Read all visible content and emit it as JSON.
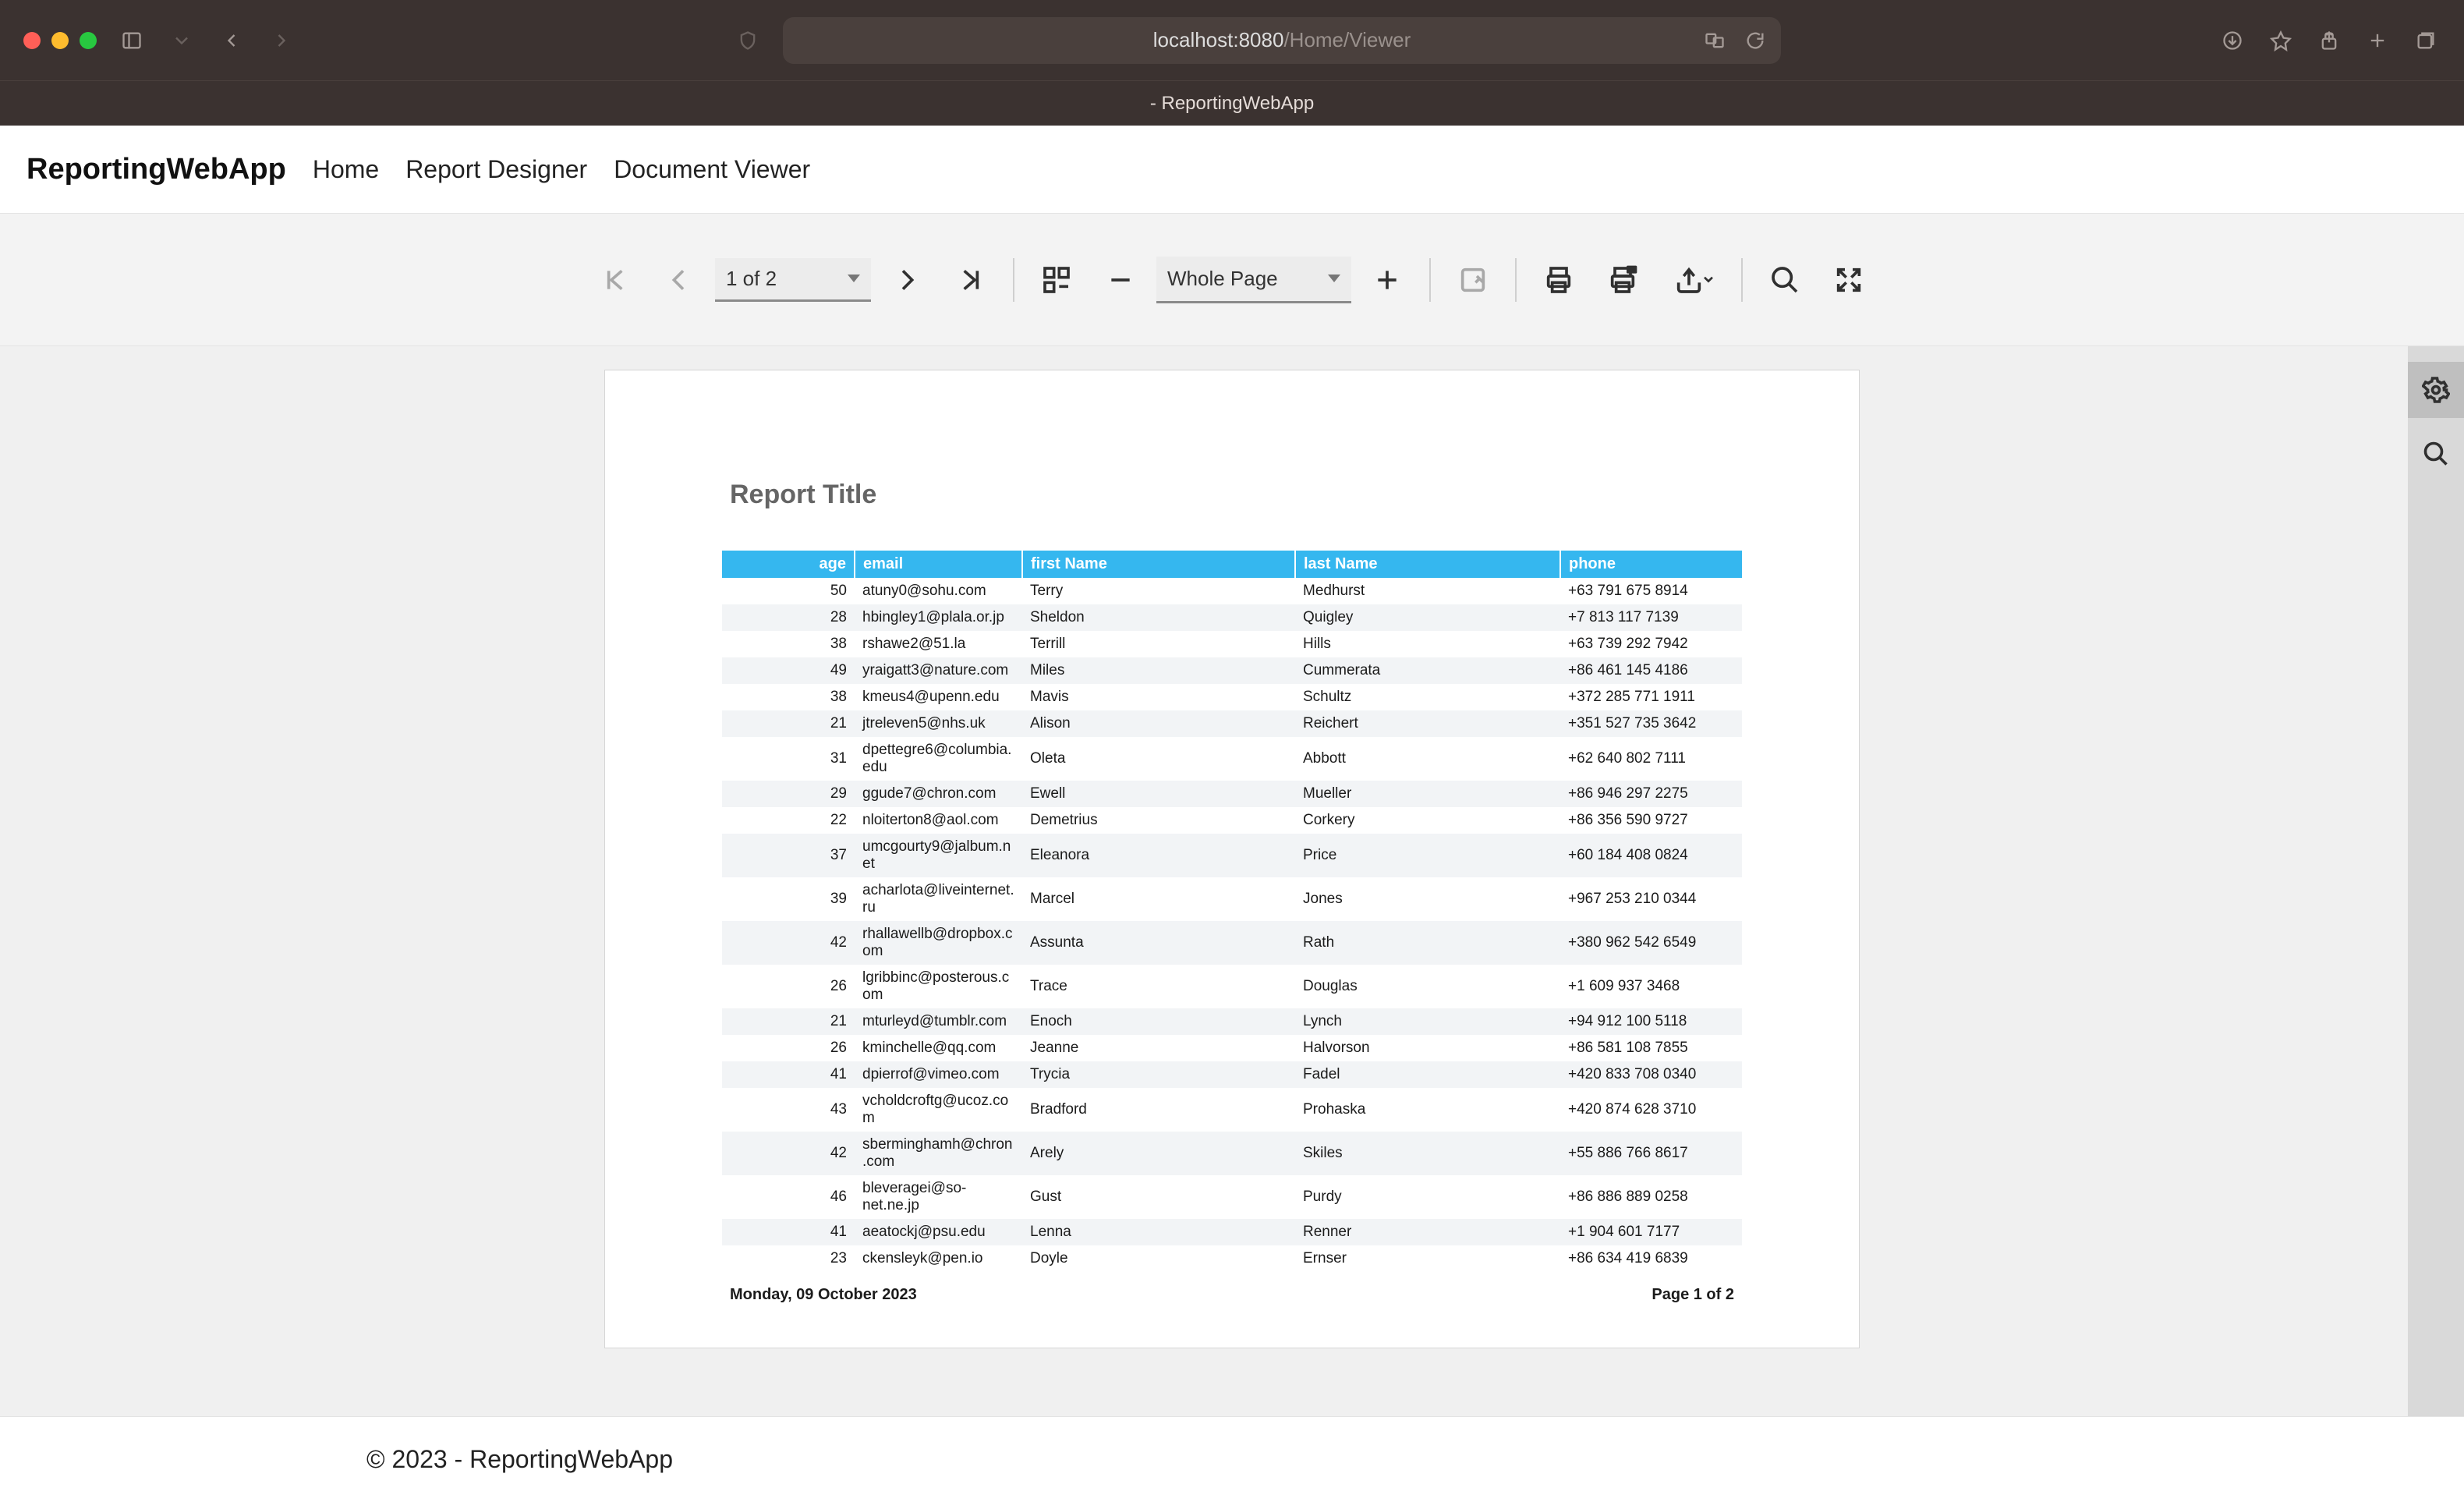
{
  "browser": {
    "url_host": "localhost:8080",
    "url_path": "/Home/Viewer",
    "tab_title": "- ReportingWebApp"
  },
  "nav": {
    "brand": "ReportingWebApp",
    "links": {
      "home": "Home",
      "designer": "Report Designer",
      "viewer": "Document Viewer"
    }
  },
  "toolbar": {
    "page_indicator": "1 of 2",
    "zoom_mode": "Whole Page"
  },
  "report": {
    "title": "Report Title",
    "columns": {
      "age": "age",
      "email": "email",
      "first_name": "first Name",
      "last_name": "last Name",
      "phone": "phone"
    },
    "rows": [
      {
        "age": "50",
        "email": "atuny0@sohu.com",
        "first": "Terry",
        "last": "Medhurst",
        "phone": "+63 791 675 8914"
      },
      {
        "age": "28",
        "email": "hbingley1@plala.or.jp",
        "first": "Sheldon",
        "last": "Quigley",
        "phone": "+7 813 117 7139"
      },
      {
        "age": "38",
        "email": "rshawe2@51.la",
        "first": "Terrill",
        "last": "Hills",
        "phone": "+63 739 292 7942"
      },
      {
        "age": "49",
        "email": "yraigatt3@nature.com",
        "first": "Miles",
        "last": "Cummerata",
        "phone": "+86 461 145 4186"
      },
      {
        "age": "38",
        "email": "kmeus4@upenn.edu",
        "first": "Mavis",
        "last": "Schultz",
        "phone": "+372 285 771 1911"
      },
      {
        "age": "21",
        "email": "jtreleven5@nhs.uk",
        "first": "Alison",
        "last": "Reichert",
        "phone": "+351 527 735 3642"
      },
      {
        "age": "31",
        "email": "dpettegre6@columbia.edu",
        "first": "Oleta",
        "last": "Abbott",
        "phone": "+62 640 802 7111"
      },
      {
        "age": "29",
        "email": "ggude7@chron.com",
        "first": "Ewell",
        "last": "Mueller",
        "phone": "+86 946 297 2275"
      },
      {
        "age": "22",
        "email": "nloiterton8@aol.com",
        "first": "Demetrius",
        "last": "Corkery",
        "phone": "+86 356 590 9727"
      },
      {
        "age": "37",
        "email": "umcgourty9@jalbum.net",
        "first": "Eleanora",
        "last": "Price",
        "phone": "+60 184 408 0824"
      },
      {
        "age": "39",
        "email": "acharlota@liveinternet.ru",
        "first": "Marcel",
        "last": "Jones",
        "phone": "+967 253 210 0344"
      },
      {
        "age": "42",
        "email": "rhallawellb@dropbox.com",
        "first": "Assunta",
        "last": "Rath",
        "phone": "+380 962 542 6549"
      },
      {
        "age": "26",
        "email": "lgribbinc@posterous.com",
        "first": "Trace",
        "last": "Douglas",
        "phone": "+1 609 937 3468"
      },
      {
        "age": "21",
        "email": "mturleyd@tumblr.com",
        "first": "Enoch",
        "last": "Lynch",
        "phone": "+94 912 100 5118"
      },
      {
        "age": "26",
        "email": "kminchelle@qq.com",
        "first": "Jeanne",
        "last": "Halvorson",
        "phone": "+86 581 108 7855"
      },
      {
        "age": "41",
        "email": "dpierrof@vimeo.com",
        "first": "Trycia",
        "last": "Fadel",
        "phone": "+420 833 708 0340"
      },
      {
        "age": "43",
        "email": "vcholdcroftg@ucoz.com",
        "first": "Bradford",
        "last": "Prohaska",
        "phone": "+420 874 628 3710"
      },
      {
        "age": "42",
        "email": "sberminghamh@chron.com",
        "first": "Arely",
        "last": "Skiles",
        "phone": "+55 886 766 8617"
      },
      {
        "age": "46",
        "email": "bleveragei@so-net.ne.jp",
        "first": "Gust",
        "last": "Purdy",
        "phone": "+86 886 889 0258"
      },
      {
        "age": "41",
        "email": "aeatockj@psu.edu",
        "first": "Lenna",
        "last": "Renner",
        "phone": "+1 904 601 7177"
      },
      {
        "age": "23",
        "email": "ckensleyk@pen.io",
        "first": "Doyle",
        "last": "Ernser",
        "phone": "+86 634 419 6839"
      }
    ],
    "footer_date": "Monday, 09 October 2023",
    "footer_page": "Page 1 of 2"
  },
  "footer": {
    "copyright": "© 2023 - ReportingWebApp"
  }
}
